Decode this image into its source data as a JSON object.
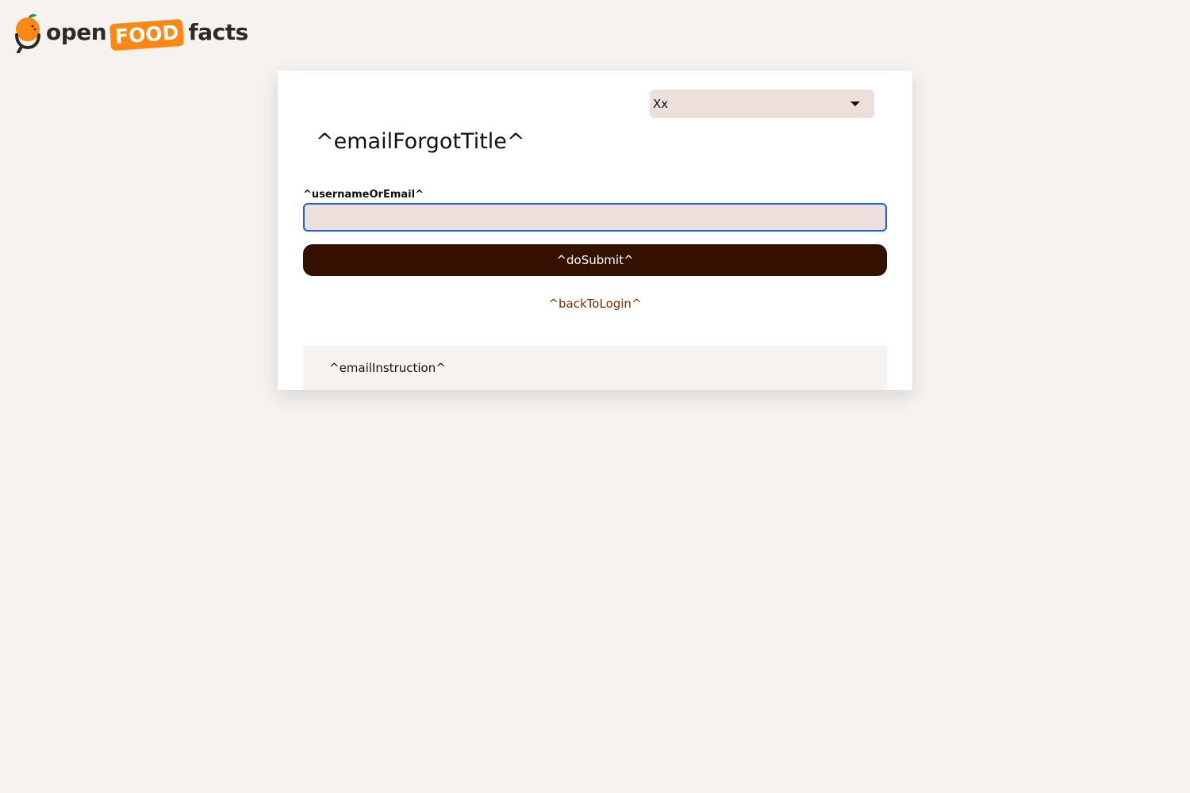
{
  "header": {
    "logo": {
      "word_before": "open",
      "word_highlight": "FOOD",
      "word_after": "facts"
    }
  },
  "card": {
    "language_select": {
      "value": "Xx"
    },
    "title": "^emailForgotTitle^",
    "username_field": {
      "label": "^usernameOrEmail^",
      "value": "",
      "placeholder": ""
    },
    "submit_button": "^doSubmit^",
    "back_link": "^backToLogin^",
    "instruction": "^emailInstruction^"
  },
  "colors": {
    "page_background": "#f6f2ef",
    "input_background": "#eddfdc",
    "input_focus_border": "#1c63d6",
    "button_background": "#341100",
    "link_color": "#7a2f08",
    "brand_orange": "#ff8714"
  }
}
